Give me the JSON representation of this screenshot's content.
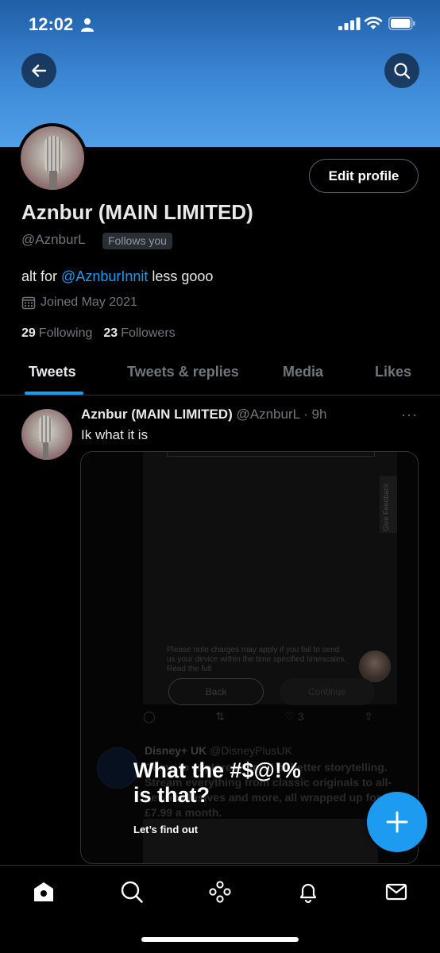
{
  "status_bar": {
    "time": "12:02"
  },
  "profile": {
    "display_name": "Aznbur (MAIN LIMITED)",
    "handle": "@AznburL",
    "follows_you_badge": "Follows you",
    "bio_prefix": "alt for",
    "bio_mention": "@AznburInnit",
    "bio_suffix": "less gooo",
    "joined": "Joined May 2021",
    "following_count": "29",
    "following_label": "Following",
    "followers_count": "23",
    "followers_label": "Followers",
    "edit_profile_label": "Edit profile"
  },
  "tabs": [
    {
      "label": "Tweets",
      "active": true
    },
    {
      "label": "Tweets & replies",
      "active": false
    },
    {
      "label": "Media",
      "active": false
    },
    {
      "label": "Likes",
      "active": false
    }
  ],
  "tweet": {
    "author_name": "Aznbur (MAIN LIMITED)",
    "author_meta": "@AznburL · 9h",
    "more": "···",
    "text": "Ik what it is",
    "media": {
      "feedback_label": "Give Feedback",
      "note": "Please note charges may apply if you fail to send us your device within the time specified timescales. Read the full",
      "back_label": "Back",
      "continue_label": "Continue",
      "like_count": "3",
      "inner_author": "Disney+ UK",
      "inner_handle": "@DisneyPlusUK",
      "inner_text": "Come to explore a world of better storytelling. Stream everything from classic originals to all-new exclusives and more, all wrapped up for just £7.99 a month."
    }
  },
  "ad_overlay": {
    "headline_line1": "What the #$@!%",
    "headline_line2": "is that?",
    "subtext": "Let’s find out"
  },
  "colors": {
    "accent": "#1d9bf0",
    "background": "#000000",
    "secondary_text": "#71767b"
  },
  "icons": {
    "back": "arrow-left-icon",
    "search": "search-icon",
    "compose": "plus-icon",
    "nav": [
      "home-icon",
      "search-icon",
      "spaces-icon",
      "bell-icon",
      "mail-icon"
    ]
  }
}
